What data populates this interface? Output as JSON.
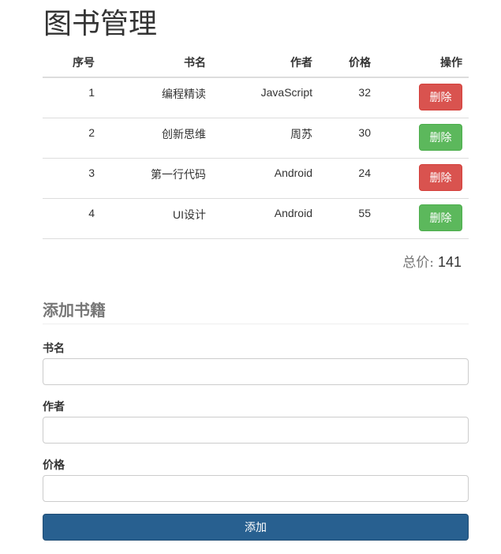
{
  "page": {
    "title": "图书管理"
  },
  "table": {
    "headers": [
      "序号",
      "书名",
      "作者",
      "价格",
      "操作"
    ],
    "rows": [
      {
        "index": "1",
        "name": "编程精读",
        "author": "JavaScript",
        "price": "32",
        "action": "删除",
        "action_style": "danger"
      },
      {
        "index": "2",
        "name": "创新思维",
        "author": "周苏",
        "price": "30",
        "action": "删除",
        "action_style": "success"
      },
      {
        "index": "3",
        "name": "第一行代码",
        "author": "Android",
        "price": "24",
        "action": "删除",
        "action_style": "danger"
      },
      {
        "index": "4",
        "name": "UI设计",
        "author": "Android",
        "price": "55",
        "action": "删除",
        "action_style": "success"
      }
    ]
  },
  "summary": {
    "total_label": "总价:",
    "total_value": "141"
  },
  "form": {
    "title": "添加书籍",
    "fields": [
      {
        "label": "书名",
        "value": "",
        "placeholder": ""
      },
      {
        "label": "作者",
        "value": "",
        "placeholder": ""
      },
      {
        "label": "价格",
        "value": "",
        "placeholder": ""
      }
    ],
    "submit_label": "添加"
  },
  "colors": {
    "danger": "#d9534f",
    "success": "#5cb85c",
    "primary": "#286090"
  }
}
